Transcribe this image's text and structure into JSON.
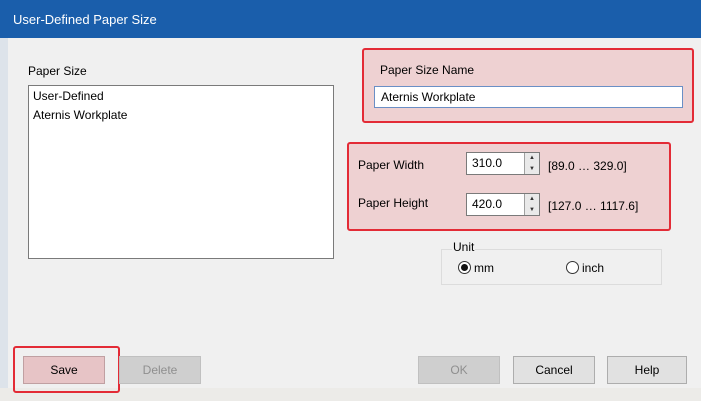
{
  "window": {
    "title": "User-Defined Paper Size"
  },
  "paper_size": {
    "label": "Paper Size",
    "items": [
      "User-Defined",
      "Aternis Workplate"
    ]
  },
  "paper_size_name": {
    "label": "Paper Size Name",
    "value": "Aternis Workplate"
  },
  "paper_width": {
    "label": "Paper Width",
    "value": "310.0",
    "range": "[89.0 … 329.0]"
  },
  "paper_height": {
    "label": "Paper Height",
    "value": "420.0",
    "range": "[127.0 … 1117.6]"
  },
  "unit": {
    "label": "Unit",
    "options": [
      {
        "label": "mm",
        "selected": true
      },
      {
        "label": "inch",
        "selected": false
      }
    ]
  },
  "buttons": {
    "save": "Save",
    "delete": "Delete",
    "ok": "OK",
    "cancel": "Cancel",
    "help": "Help"
  },
  "colors": {
    "title_bar": "#1a5eab",
    "highlight": "#e32b36"
  }
}
